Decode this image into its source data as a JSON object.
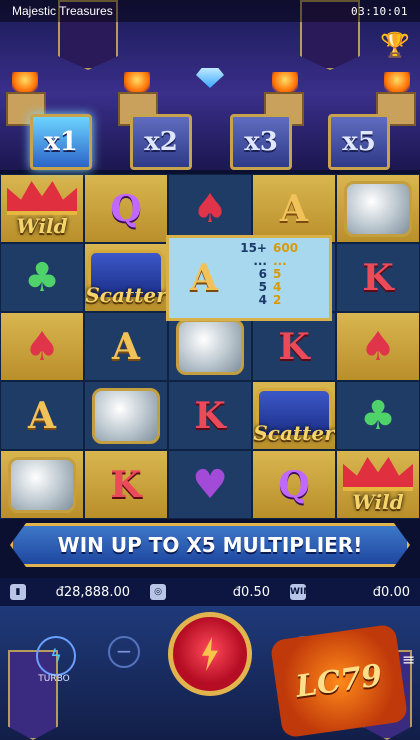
{
  "window": {
    "title": "Majestic Treasures",
    "time": "03:10:01"
  },
  "multipliers": [
    {
      "label": "x1",
      "active": true
    },
    {
      "label": "x2",
      "active": false
    },
    {
      "label": "x3",
      "active": false
    },
    {
      "label": "x5",
      "active": false
    }
  ],
  "reels": {
    "rows": [
      [
        "Wild",
        "Q",
        "spade",
        "A",
        "diamond"
      ],
      [
        "club",
        "Scatter",
        "A",
        "A",
        "K"
      ],
      [
        "spade",
        "A",
        "diamond",
        "K",
        "spade"
      ],
      [
        "A",
        "diamond",
        "K",
        "Scatter",
        "club"
      ],
      [
        "diamond",
        "K",
        "heart",
        "Q",
        "Wild"
      ]
    ]
  },
  "paytable": {
    "symbol": "A",
    "rows": [
      {
        "count": "15+",
        "multiplier": "600"
      },
      {
        "count": "...",
        "multiplier": "..."
      },
      {
        "count": "6",
        "multiplier": "5"
      },
      {
        "count": "5",
        "multiplier": "4"
      },
      {
        "count": "4",
        "multiplier": "2"
      }
    ]
  },
  "banner": {
    "text": "WIN UP TO X5 MULTIPLIER!"
  },
  "balances": {
    "balance": "đ28,888.00",
    "bet": "đ0.50",
    "win": "đ0.00",
    "win_icon_label": "WIN"
  },
  "controls": {
    "turbo_label": "TURBO",
    "minus_label": "−",
    "plus_label": "+",
    "menu_label": "≡"
  },
  "logo": {
    "text": "LC79"
  },
  "colors": {
    "gold": "#e2b44e",
    "active_multiplier": "#6cd4ff",
    "spin": "#d11a30"
  }
}
